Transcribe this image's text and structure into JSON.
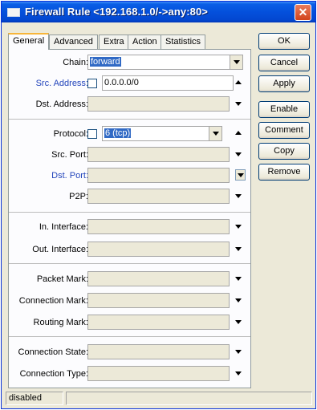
{
  "window": {
    "title": "Firewall Rule <192.168.1.0/->any:80>"
  },
  "tabs": [
    "General",
    "Advanced",
    "Extra",
    "Action",
    "Statistics"
  ],
  "fields": {
    "chain": {
      "label": "Chain:",
      "value": "forward"
    },
    "src_address": {
      "label": "Src. Address:",
      "value": "0.0.0.0/0"
    },
    "dst_address": {
      "label": "Dst. Address:",
      "value": ""
    },
    "protocol": {
      "label": "Protocol:",
      "value": "6 (tcp)"
    },
    "src_port": {
      "label": "Src. Port:",
      "value": ""
    },
    "dst_port": {
      "label": "Dst. Port:",
      "value": ""
    },
    "p2p": {
      "label": "P2P:",
      "value": ""
    },
    "in_interface": {
      "label": "In. Interface:",
      "value": ""
    },
    "out_interface": {
      "label": "Out. Interface:",
      "value": ""
    },
    "packet_mark": {
      "label": "Packet Mark:",
      "value": ""
    },
    "connection_mark": {
      "label": "Connection Mark:",
      "value": ""
    },
    "routing_mark": {
      "label": "Routing Mark:",
      "value": ""
    },
    "connection_state": {
      "label": "Connection State:",
      "value": ""
    },
    "connection_type": {
      "label": "Connection Type:",
      "value": ""
    }
  },
  "buttons": {
    "ok": "OK",
    "cancel": "Cancel",
    "apply": "Apply",
    "enable": "Enable",
    "comment": "Comment",
    "copy": "Copy",
    "remove": "Remove"
  },
  "status": {
    "state": "disabled"
  },
  "colors": {
    "title_bar": "#0450dc",
    "selection": "#316ac5",
    "link_label": "#2244bb"
  }
}
